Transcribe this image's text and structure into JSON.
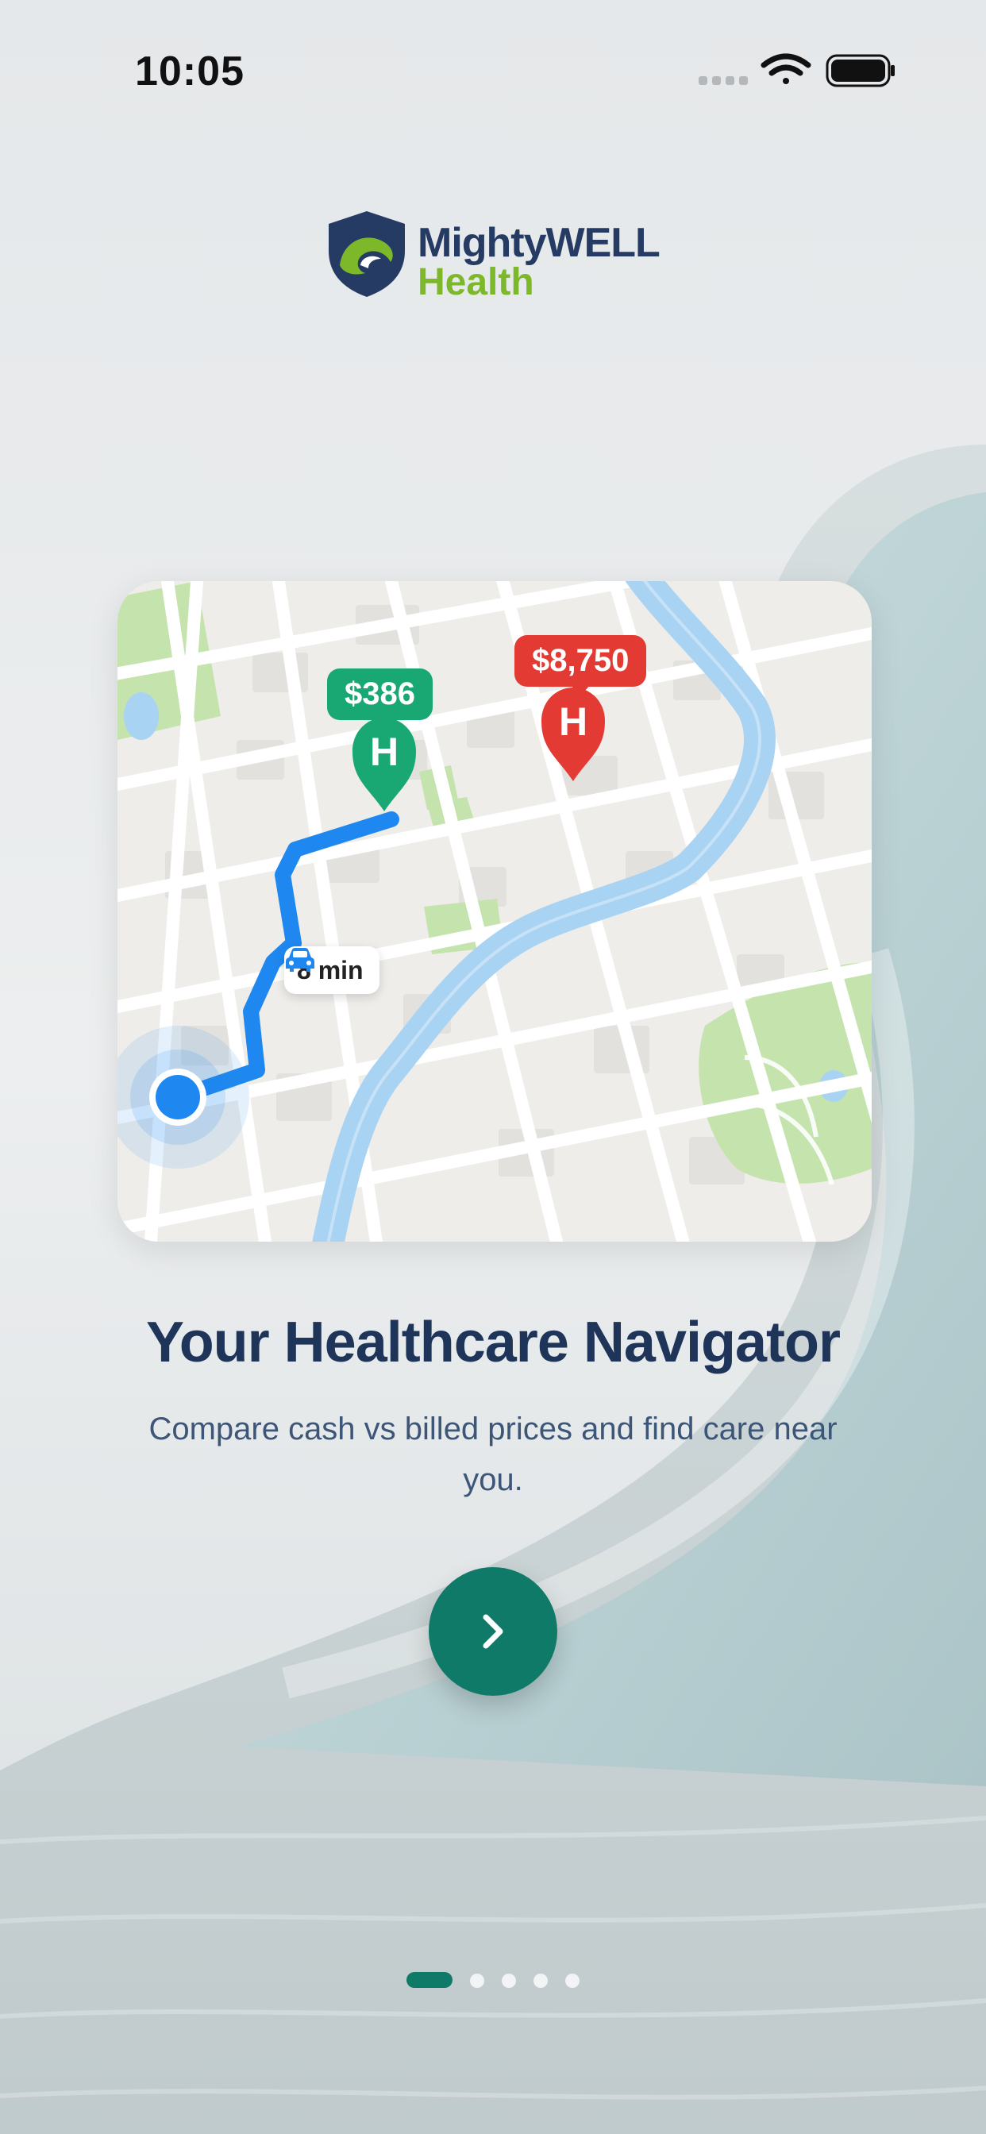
{
  "status_bar": {
    "time": "10:05",
    "icons": [
      "signal-dots-icon",
      "wifi-icon",
      "battery-icon"
    ]
  },
  "logo": {
    "line1": "MightyWELL",
    "line2": "Health",
    "colors": {
      "navy": "#263b63",
      "green": "#7db82a"
    }
  },
  "map": {
    "pins": [
      {
        "label": "$386",
        "color": "#19a873",
        "icon": "hospital-pin-icon"
      },
      {
        "label": "$8,750",
        "color": "#e33b34",
        "icon": "hospital-pin-icon"
      }
    ],
    "pin_glyph": "H",
    "travel_time": "8 min",
    "travel_icon": "car-icon",
    "route_color": "#1e88f0",
    "river_color": "#a9d3f2",
    "park_color": "#c4e3ad"
  },
  "content": {
    "title": "Your Healthcare Navigator",
    "subtitle": "Compare cash vs billed prices and find care near you."
  },
  "next_button": {
    "icon": "chevron-right-icon",
    "color": "#0f7a68"
  },
  "pagination": {
    "total": 5,
    "active": 1
  }
}
